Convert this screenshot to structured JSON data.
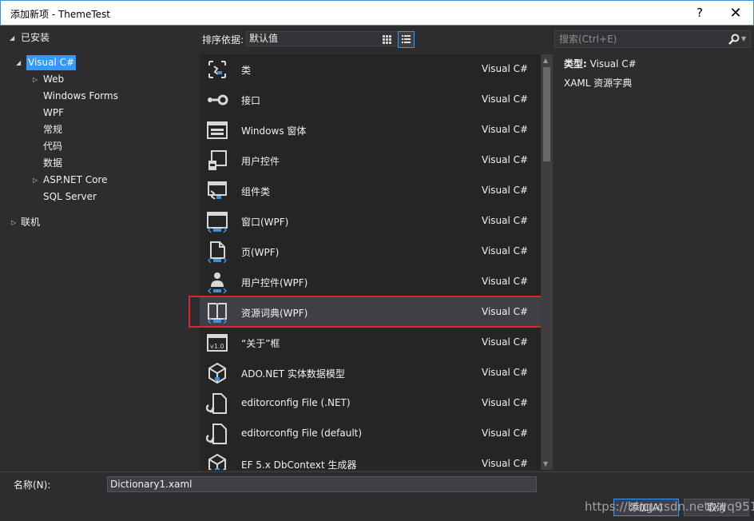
{
  "window": {
    "title": "添加新项 - ThemeTest",
    "help_label": "?",
    "close_label": "✕"
  },
  "tree": {
    "installed_label": "已安装",
    "root_label": "Visual C#",
    "children": [
      "Web",
      "Windows Forms",
      "WPF",
      "常规",
      "代码",
      "数据",
      "ASP.NET Core",
      "SQL Server"
    ],
    "online_label": "联机"
  },
  "toolbar": {
    "sort_label": "排序依据:",
    "sort_value": "默认值"
  },
  "search": {
    "placeholder": "搜索(Ctrl+E)"
  },
  "templates": [
    {
      "name": "类",
      "lang": "Visual C#",
      "icon": "class-icon"
    },
    {
      "name": "接口",
      "lang": "Visual C#",
      "icon": "interface-icon"
    },
    {
      "name": "Windows 窗体",
      "lang": "Visual C#",
      "icon": "windows-form-icon"
    },
    {
      "name": "用户控件",
      "lang": "Visual C#",
      "icon": "user-control-icon"
    },
    {
      "name": "组件类",
      "lang": "Visual C#",
      "icon": "component-class-icon"
    },
    {
      "name": "窗口(WPF)",
      "lang": "Visual C#",
      "icon": "wpf-window-icon"
    },
    {
      "name": "页(WPF)",
      "lang": "Visual C#",
      "icon": "wpf-page-icon"
    },
    {
      "name": "用户控件(WPF)",
      "lang": "Visual C#",
      "icon": "wpf-user-control-icon"
    },
    {
      "name": "资源词典(WPF)",
      "lang": "Visual C#",
      "icon": "resource-dictionary-icon",
      "selected": true
    },
    {
      "name": "“关于”框",
      "lang": "Visual C#",
      "icon": "about-box-icon"
    },
    {
      "name": "ADO.NET 实体数据模型",
      "lang": "Visual C#",
      "icon": "ado-net-model-icon"
    },
    {
      "name": "editorconfig File (.NET)",
      "lang": "Visual C#",
      "icon": "editorconfig-icon"
    },
    {
      "name": "editorconfig File (default)",
      "lang": "Visual C#",
      "icon": "editorconfig-icon"
    },
    {
      "name": "EF 5.x DbContext 生成器",
      "lang": "Visual C#",
      "icon": "dbcontext-generator-icon"
    }
  ],
  "details": {
    "type_label": "类型:",
    "type_value": "Visual C#",
    "description": "XAML 资源字典"
  },
  "bottom": {
    "name_label": "名称(N):",
    "name_value": "Dictionary1.xaml",
    "add_label": "添加(A)",
    "cancel_label": "取消",
    "watermark": "https://blog.csdn.net/xyq9511"
  }
}
